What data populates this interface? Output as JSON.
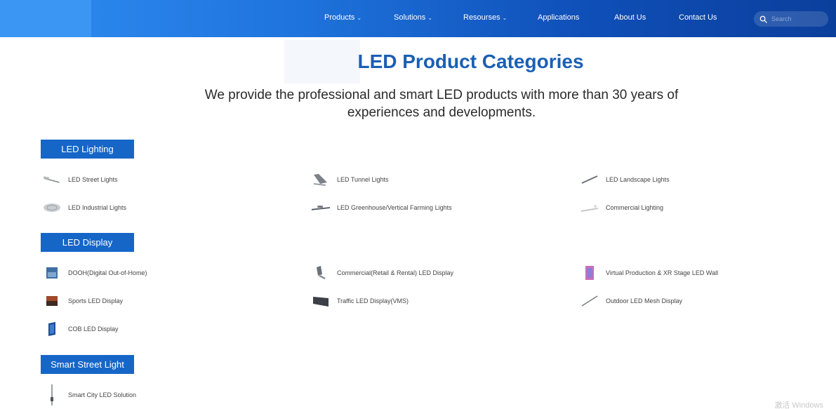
{
  "header": {
    "nav": [
      {
        "label": "Products",
        "caret": "⌄"
      },
      {
        "label": "Solutions",
        "caret": "⌄"
      },
      {
        "label": "Resourses",
        "caret": "⌄"
      },
      {
        "label": "Applications",
        "caret": ""
      },
      {
        "label": "About Us",
        "caret": ""
      },
      {
        "label": "Contact Us",
        "caret": ""
      }
    ],
    "search_placeholder": "Search"
  },
  "main": {
    "title": "LED Product Categories",
    "subtitle_line1": "We provide the professional and smart LED products with more than 30 years of",
    "subtitle_line2": "experiences and developments."
  },
  "sections": {
    "lighting": {
      "label": "LED Lighting",
      "items": [
        {
          "label": "LED Street Lights",
          "icon": "street-light-icon"
        },
        {
          "label": "LED Tunnel Lights",
          "icon": "tunnel-light-icon"
        },
        {
          "label": "LED Landscape Lights",
          "icon": "landscape-light-icon"
        },
        {
          "label": "LED Industrial Lights",
          "icon": "industrial-light-icon"
        },
        {
          "label": "LED Greenhouse/Vertical Farming Lights",
          "icon": "greenhouse-light-icon"
        },
        {
          "label": "Commercial Lighting",
          "icon": "commercial-light-icon"
        }
      ]
    },
    "display": {
      "label": "LED Display",
      "items": [
        {
          "label": "DOOH(Digital Out-of-Home)",
          "icon": "dooh-display-icon"
        },
        {
          "label": "Commercial(Retail & Rental) LED Display",
          "icon": "commercial-display-icon"
        },
        {
          "label": "Virtual Production & XR Stage LED Wall",
          "icon": "xr-stage-icon"
        },
        {
          "label": "Sports LED Display",
          "icon": "sports-display-icon"
        },
        {
          "label": "Traffic LED Display(VMS)",
          "icon": "traffic-display-icon"
        },
        {
          "label": "Outdoor LED Mesh Display",
          "icon": "mesh-display-icon"
        },
        {
          "label": "COB LED Display",
          "icon": "cob-display-icon"
        }
      ]
    },
    "smart": {
      "label": "Smart Street Light",
      "items": [
        {
          "label": "Smart City LED Solution",
          "icon": "smart-pole-icon"
        }
      ]
    }
  },
  "watermark": "激活 Windows",
  "colors": {
    "accent": "#1666c8",
    "title": "#1a5fb4",
    "header_dark": "#0b3f9c",
    "header_light": "#3a95f3"
  }
}
